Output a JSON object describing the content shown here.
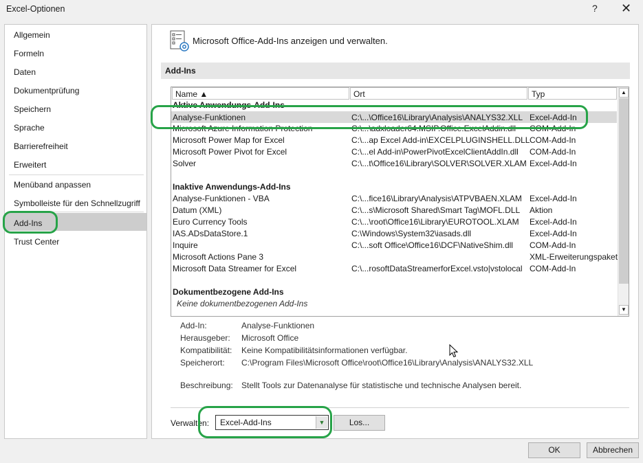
{
  "window": {
    "title": "Excel-Optionen",
    "help_glyph": "?",
    "close_glyph": "✕"
  },
  "nav": {
    "items": [
      "Allgemein",
      "Formeln",
      "Daten",
      "Dokumentprüfung",
      "Speichern",
      "Sprache",
      "Barrierefreiheit",
      "Erweitert",
      "Menüband anpassen",
      "Symbolleiste für den Schnellzugriff",
      "Add-Ins",
      "Trust Center"
    ],
    "selected": "Add-Ins"
  },
  "main": {
    "header": "Microsoft Office-Add-Ins anzeigen und verwalten.",
    "section_title": "Add-Ins",
    "columns": {
      "name": "Name ▲",
      "location": "Ort",
      "type": "Typ"
    },
    "groups": {
      "active": "Aktive Anwendungs-Add-Ins",
      "inactive": "Inaktive Anwendungs-Add-Ins",
      "document": "Dokumentbezogene Add-Ins",
      "document_empty": "Keine dokumentbezogenen Add-Ins"
    },
    "active_rows": [
      {
        "name": "Analyse-Funktionen",
        "location": "C:\\...\\Office16\\Library\\Analysis\\ANALYS32.XLL",
        "type": "Excel-Add-In"
      },
      {
        "name": "Microsoft Azure Information Protection",
        "location": "C:\\...\\adxloader64.MSIP.Office.ExcelAddin.dll",
        "type": "COM-Add-In"
      },
      {
        "name": "Microsoft Power Map for Excel",
        "location": "C:\\...ap Excel Add-in\\EXCELPLUGINSHELL.DLL",
        "type": "COM-Add-In"
      },
      {
        "name": "Microsoft Power Pivot for Excel",
        "location": "C:\\...el Add-in\\PowerPivotExcelClientAddIn.dll",
        "type": "COM-Add-In"
      },
      {
        "name": "Solver",
        "location": "C:\\...t\\Office16\\Library\\SOLVER\\SOLVER.XLAM",
        "type": "Excel-Add-In"
      }
    ],
    "inactive_rows": [
      {
        "name": "Analyse-Funktionen - VBA",
        "location": "C:\\...fice16\\Library\\Analysis\\ATPVBAEN.XLAM",
        "type": "Excel-Add-In"
      },
      {
        "name": "Datum (XML)",
        "location": "C:\\...s\\Microsoft Shared\\Smart Tag\\MOFL.DLL",
        "type": "Aktion"
      },
      {
        "name": "Euro Currency Tools",
        "location": "C:\\...\\root\\Office16\\Library\\EUROTOOL.XLAM",
        "type": "Excel-Add-In"
      },
      {
        "name": "IAS.ADsDataStore.1",
        "location": "C:\\Windows\\System32\\iasads.dll",
        "type": "Excel-Add-In"
      },
      {
        "name": "Inquire",
        "location": "C:\\...soft Office\\Office16\\DCF\\NativeShim.dll",
        "type": "COM-Add-In"
      },
      {
        "name": "Microsoft Actions Pane 3",
        "location": "",
        "type": "XML-Erweiterungspaket"
      },
      {
        "name": "Microsoft Data Streamer for Excel",
        "location": "C:\\...rosoftDataStreamerforExcel.vsto|vstolocal",
        "type": "COM-Add-In"
      }
    ],
    "details": {
      "addin_label": "Add-In:",
      "addin_value": "Analyse-Funktionen",
      "publisher_label": "Herausgeber:",
      "publisher_value": "Microsoft Office",
      "compat_label": "Kompatibilität:",
      "compat_value": "Keine Kompatibilitätsinformationen verfügbar.",
      "location_label": "Speicherort:",
      "location_value": "C:\\Program Files\\Microsoft Office\\root\\Office16\\Library\\Analysis\\ANALYS32.XLL",
      "desc_label": "Beschreibung:",
      "desc_value": "Stellt Tools zur Datenanalyse für statistische und technische Analysen bereit."
    },
    "manage": {
      "label": "Verwalten:",
      "selected": "Excel-Add-Ins",
      "go_label": "Los..."
    }
  },
  "buttons": {
    "ok": "OK",
    "cancel": "Abbrechen"
  },
  "colors": {
    "highlight": "#27a348",
    "selection": "#d9d9d9"
  }
}
